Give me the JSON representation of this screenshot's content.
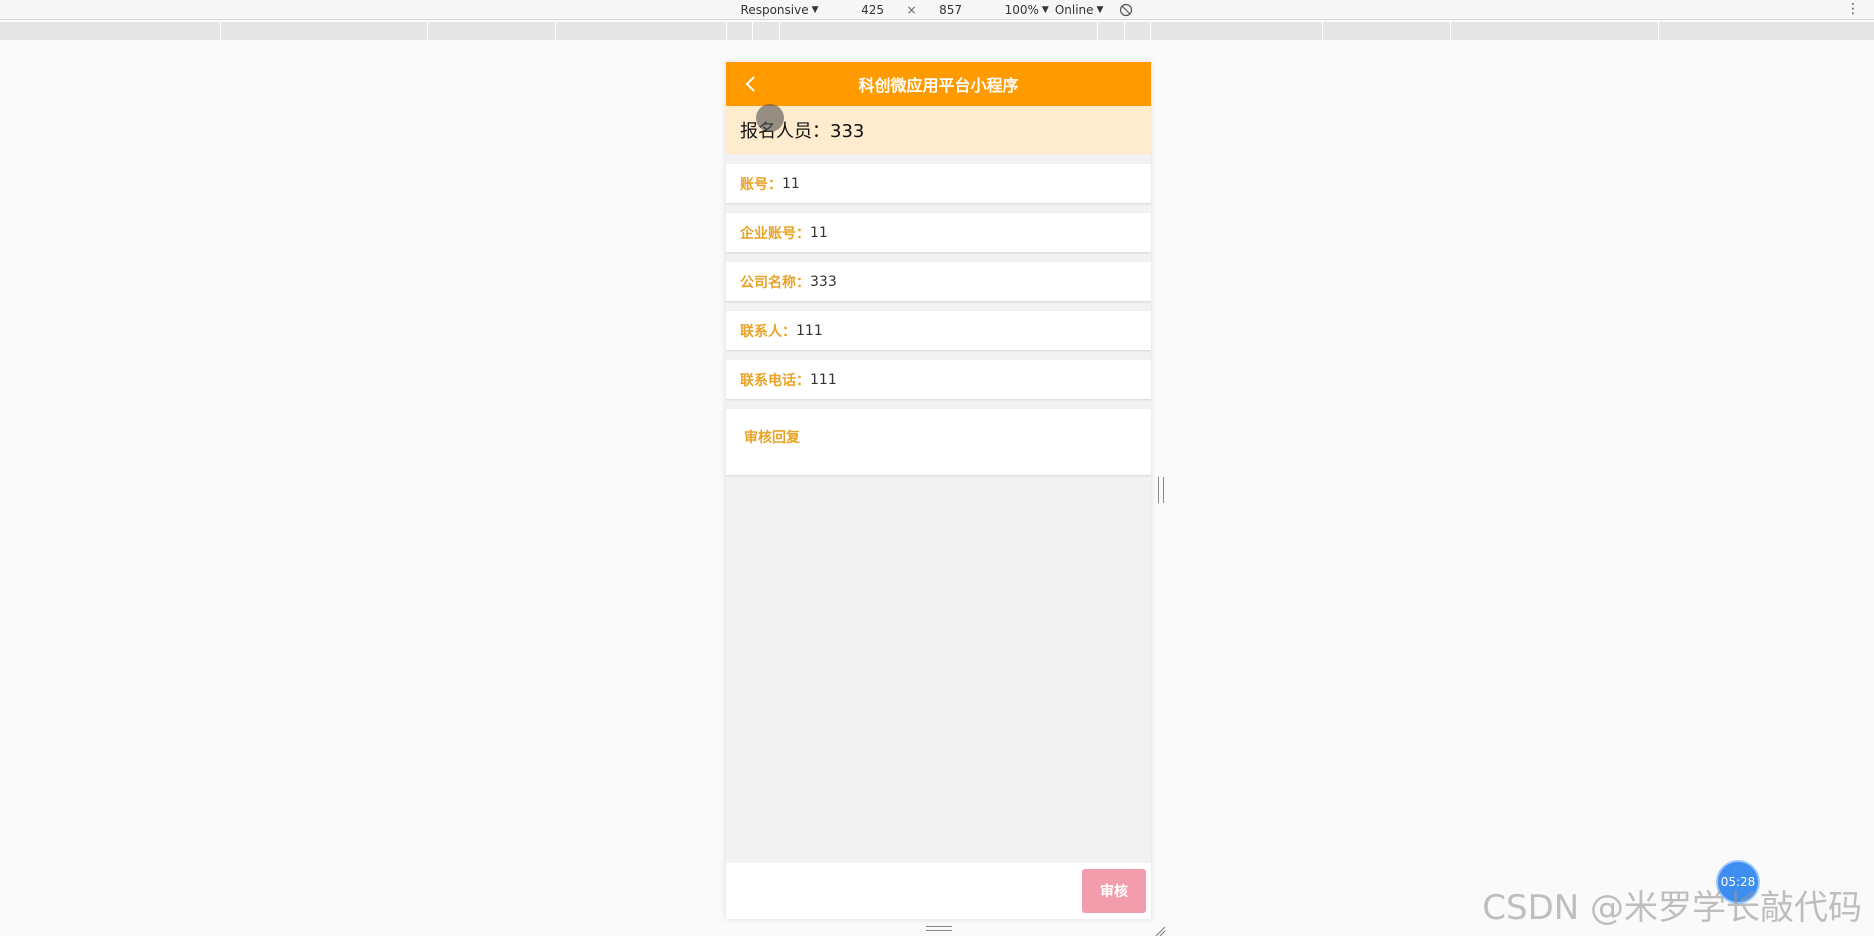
{
  "devtools": {
    "device_mode": "Responsive",
    "width": "425",
    "times": "×",
    "height": "857",
    "zoom": "100%",
    "throttle": "Online",
    "rotate_icon": "rotate-icon",
    "more_icon": "kebab-icon"
  },
  "app": {
    "title": "科创微应用平台小程序",
    "back_icon": "chevron-left-icon",
    "headline": "报名人员：333",
    "fields": [
      {
        "label": "账号",
        "sep": "：",
        "value": "11"
      },
      {
        "label": "企业账号",
        "sep": "：",
        "value": "11"
      },
      {
        "label": "公司名称",
        "sep": "：",
        "value": "333"
      },
      {
        "label": "联系人",
        "sep": "：",
        "value": "111"
      },
      {
        "label": "联系电话",
        "sep": "：",
        "value": "111"
      }
    ],
    "reply_label": "审核回复",
    "audit_button": "审核"
  },
  "overlay": {
    "timer": "05:28",
    "watermark": "CSDN @米罗学长敲代码"
  },
  "colors": {
    "nav": "#ff9b00",
    "headline_bg": "#ffebcd",
    "label": "#e9a325",
    "button": "#f29cac"
  }
}
